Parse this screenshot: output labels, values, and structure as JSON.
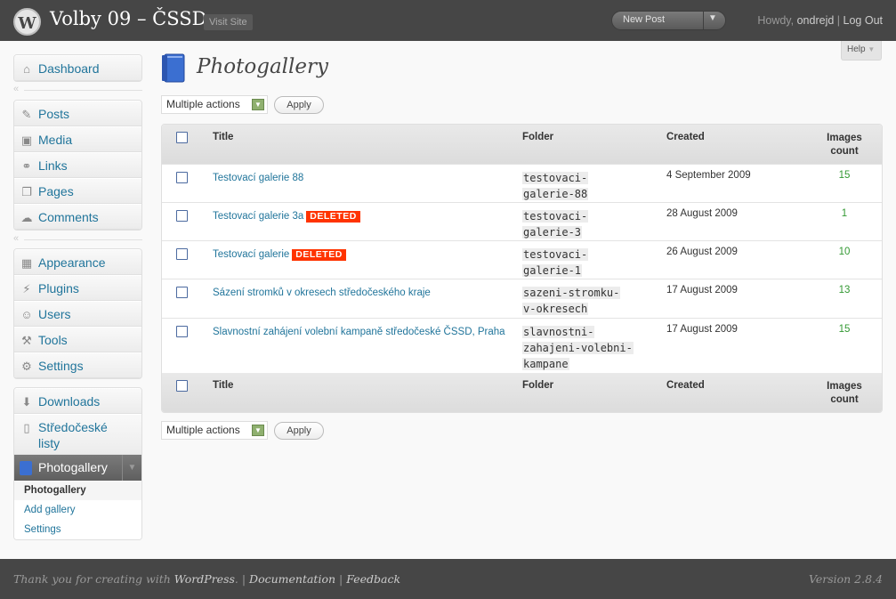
{
  "header": {
    "site_title": "Volby 09 – ČSSD",
    "visit_site": "Visit Site",
    "new_post": "New Post",
    "howdy": "Howdy,",
    "username": "ondrejd",
    "separator": "|",
    "logout": "Log Out",
    "help": "Help"
  },
  "sidebar": {
    "group1": [
      {
        "label": "Dashboard",
        "icon": "home-icon"
      }
    ],
    "group2": [
      {
        "label": "Posts",
        "icon": "pin-icon"
      },
      {
        "label": "Media",
        "icon": "media-icon"
      },
      {
        "label": "Links",
        "icon": "link-icon"
      },
      {
        "label": "Pages",
        "icon": "pages-icon"
      },
      {
        "label": "Comments",
        "icon": "comments-icon"
      }
    ],
    "group3": [
      {
        "label": "Appearance",
        "icon": "appearance-icon"
      },
      {
        "label": "Plugins",
        "icon": "plugins-icon"
      },
      {
        "label": "Users",
        "icon": "users-icon"
      },
      {
        "label": "Tools",
        "icon": "tools-icon"
      },
      {
        "label": "Settings",
        "icon": "settings-icon"
      }
    ],
    "group4": [
      {
        "label": "Downloads",
        "icon": "downloads-icon"
      },
      {
        "label": "Středočeské listy",
        "icon": "document-icon"
      }
    ],
    "photogallery": {
      "label": "Photogallery",
      "submenu": [
        "Photogallery",
        "Add gallery",
        "Settings"
      ]
    }
  },
  "main": {
    "page_title": "Photogallery",
    "bulk_top": "Multiple actions",
    "bulk_bottom": "Multiple actions",
    "apply": "Apply",
    "columns": {
      "title": "Title",
      "folder": "Folder",
      "created": "Created",
      "images_count_1": "Images",
      "images_count_2": "count"
    },
    "rows": [
      {
        "title": "Testovací galerie 88",
        "deleted": "",
        "folder_1": "testovaci-",
        "folder_2": "galerie-88",
        "folder_3": "",
        "created": "4 September 2009",
        "count": "15"
      },
      {
        "title": "Testovací galerie 3a",
        "deleted": "DELETED",
        "folder_1": "testovaci-",
        "folder_2": "galerie-3",
        "folder_3": "",
        "created": "28 August 2009",
        "count": "1"
      },
      {
        "title": "Testovací galerie",
        "deleted": "DELETED",
        "folder_1": "testovaci-",
        "folder_2": "galerie-1",
        "folder_3": "",
        "created": "26 August 2009",
        "count": "10"
      },
      {
        "title": "Sázení stromků v okresech středočeského kraje",
        "deleted": "",
        "folder_1": "sazeni-stromku-",
        "folder_2": "v-okresech",
        "folder_3": "",
        "created": "17 August 2009",
        "count": "13"
      },
      {
        "title": "Slavnostní zahájení volební kampaně středočeské ČSSD, Praha",
        "deleted": "",
        "folder_1": "slavnostni-",
        "folder_2": "zahajeni-volebni-",
        "folder_3": "kampane",
        "created": "17 August 2009",
        "count": "15"
      }
    ]
  },
  "footer": {
    "thanks_prefix": "Thank you for creating with",
    "wordpress": "WordPress",
    "documentation": "Documentation",
    "feedback": "Feedback",
    "version": "Version 2.8.4"
  },
  "colors": {
    "header_bg": "#464646",
    "link": "#21759b",
    "deleted_badge": "#ff3300",
    "count_green": "#339933"
  }
}
